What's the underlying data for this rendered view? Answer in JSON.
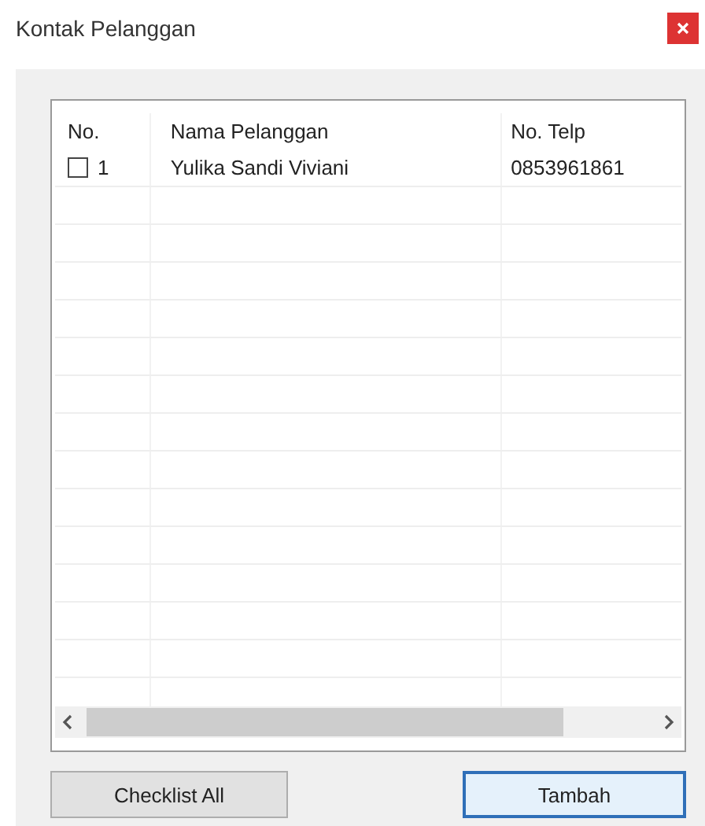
{
  "window": {
    "title": "Kontak Pelanggan"
  },
  "table": {
    "columns": [
      "No.",
      "Nama Pelanggan",
      "No. Telp"
    ],
    "rows": [
      {
        "checked": false,
        "no": "1",
        "name": "Yulika Sandi Viviani",
        "phone": "0853961861"
      }
    ]
  },
  "buttons": [
    {
      "label": "Checklist All",
      "focused": false
    },
    {
      "label": "Tambah",
      "focused": true
    }
  ]
}
